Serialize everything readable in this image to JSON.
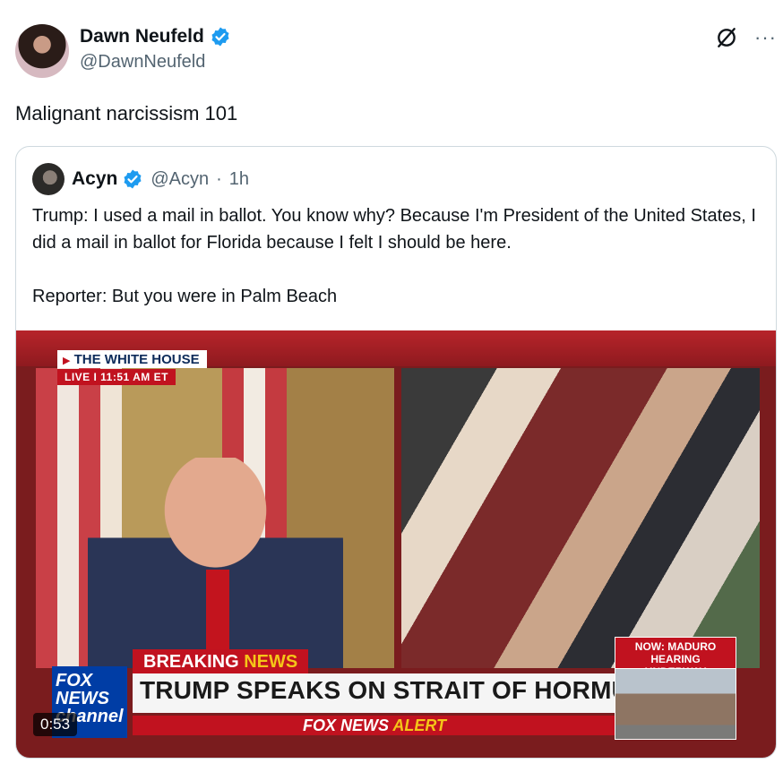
{
  "post": {
    "author_name": "Dawn Neufeld",
    "author_handle": "@DawnNeufeld",
    "text": "Malignant narcissism 101",
    "icons": {
      "verified": "verified-badge-icon",
      "grok": "grok-icon",
      "more": "more-icon"
    },
    "more_label": "···"
  },
  "quoted": {
    "author_name": "Acyn",
    "author_handle": "@Acyn",
    "separator": "·",
    "time": "1h",
    "text": "Trump: I used a mail in ballot. You know why? Because I'm President of the United States, I did a mail in ballot for Florida because I felt I should be here.\n\nReporter: But you were in Palm Beach",
    "video": {
      "duration": "0:53",
      "overlay": {
        "location": "THE WHITE HOUSE",
        "live": "LIVE  I  11:51 AM ET",
        "now_label": "NOW: MADURO HEARING UNDERWAY",
        "breaking_word": "BREAKING",
        "news_word": "NEWS",
        "headline": "TRUMP SPEAKS ON STRAIT OF HORMUZ",
        "alert_brand": "FOX NEWS",
        "alert_word": "ALERT",
        "logo_text": "FOX NEWS channel"
      }
    }
  },
  "colors": {
    "verified_blue": "#1d9bf0",
    "text_primary": "#0f1419",
    "text_secondary": "#536471",
    "fox_red": "#c1121f",
    "fox_blue": "#003da5"
  }
}
